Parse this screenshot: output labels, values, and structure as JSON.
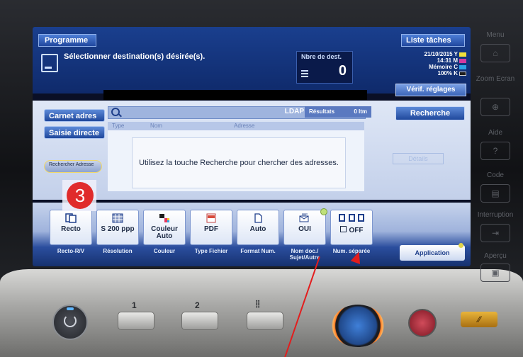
{
  "header": {
    "program_tab": "Programme",
    "jobs_tab": "Liste tâches",
    "message": "Sélectionner destination(s) désirée(s).",
    "dest_label": "Nbre de dest.",
    "dest_value": "0",
    "date": "21/10/2015",
    "time": "14:31",
    "memory_label": "Mémoire",
    "memory_value": "100%",
    "toner": [
      {
        "label": "Y",
        "color": "#f2e13b"
      },
      {
        "label": "M",
        "color": "#d43aa0"
      },
      {
        "label": "C",
        "color": "#2ea4e6"
      },
      {
        "label": "K",
        "color": "#1d1d1d"
      }
    ],
    "verif_button": "Vérif. réglages"
  },
  "search": {
    "address_book": "Carnet adres",
    "direct_input": "Saisie directe",
    "search_address": "Rechercher Adresse",
    "ldap": "LDAP",
    "results_label": "Résultats",
    "results_value": "0 Itm",
    "search_button": "Recherche",
    "columns": [
      "Type",
      "Nom",
      "Adresse"
    ],
    "message": "Utilisez la touche Recherche pour chercher des adresses.",
    "details": "Détails"
  },
  "badge": "3",
  "functions": [
    {
      "value": "Recto",
      "label": "Recto-R/V",
      "icon": "duplex-icon"
    },
    {
      "value": "S 200 ppp",
      "label": "Résolution",
      "icon": "resolution-icon"
    },
    {
      "value": "Couleur Auto",
      "label": "Couleur",
      "icon": "color-icon"
    },
    {
      "value": "PDF",
      "label": "Type Fichier",
      "icon": "pdf-icon"
    },
    {
      "value": "Auto",
      "label": "Format Num.",
      "icon": "page-icon"
    },
    {
      "value": "OUI",
      "label": "Nom doc./ Sujet/Autre",
      "icon": "mail-icon"
    },
    {
      "value": "OFF",
      "label": "Num. séparée",
      "icon": "separate-scan-icon"
    }
  ],
  "application_button": "Application",
  "side": {
    "menu": "Menu",
    "zoom": "Zoom Ecran",
    "aide": "Aide",
    "code": "Code",
    "interruption": "Interruption",
    "apercu": "Aperçu"
  },
  "keypad": [
    "1",
    "2"
  ]
}
